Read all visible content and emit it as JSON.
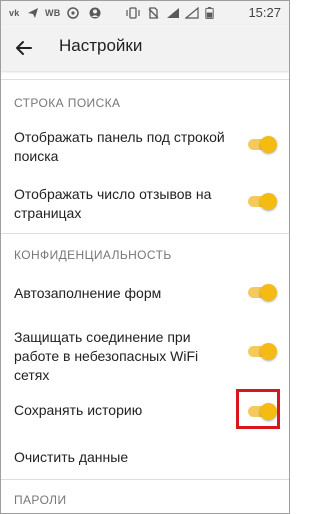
{
  "status_bar": {
    "carrier": "WB",
    "time": "15:27",
    "icons": [
      "vk-icon",
      "send-icon",
      "whatsapp-icon",
      "account-icon",
      "vibrate-icon",
      "no-sim-icon",
      "signal-icon",
      "battery-icon"
    ]
  },
  "toolbar": {
    "title": "Настройки",
    "back_icon": "arrow-back-icon"
  },
  "sections": [
    {
      "header": "СТРОКА ПОИСКА",
      "rows": [
        {
          "label": "Отображать панель под строкой поиска",
          "toggle": true
        },
        {
          "label": "Отображать число отзывов на страницах",
          "toggle": true
        }
      ]
    },
    {
      "header": "КОНФИДЕНЦИАЛЬНОСТЬ",
      "rows": [
        {
          "label": "Автозаполнение форм",
          "toggle": true
        },
        {
          "label": "Защищать соединение при работе в небезопасных WiFi сетях",
          "toggle": true
        },
        {
          "label": "Сохранять историю",
          "toggle": true
        },
        {
          "label": "Очистить данные"
        }
      ]
    },
    {
      "header": "ПАРОЛИ",
      "rows": []
    }
  ],
  "colors": {
    "toggle_on_thumb": "#f5bb13",
    "toggle_on_track": "#f5c95c",
    "highlight": "#d8161d"
  }
}
